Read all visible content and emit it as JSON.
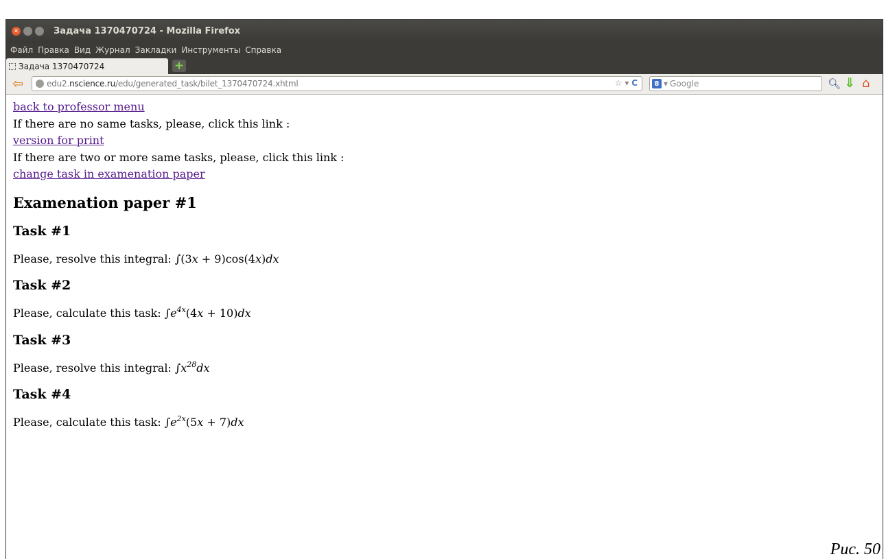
{
  "window": {
    "title": "Задача 1370470724 - Mozilla Firefox"
  },
  "menu": {
    "items": [
      {
        "label": "Файл"
      },
      {
        "label": "Правка"
      },
      {
        "label": "Вид"
      },
      {
        "label": "Журнал"
      },
      {
        "label": "Закладки"
      },
      {
        "label": "Инструменты"
      },
      {
        "label": "Справка"
      }
    ]
  },
  "tab": {
    "title": "Задача 1370470724",
    "new_tab_icon": "plus-icon"
  },
  "nav": {
    "url_host_prefix": "edu2.",
    "url_host_domain": "nscience.ru",
    "url_path": "/edu/generated_task/bilet_1370470724.xhtml",
    "search_placeholder": "Google",
    "search_engine_badge": "8"
  },
  "content": {
    "links": {
      "back": "back to professor menu",
      "print": "version for print",
      "change": "change task in examenation paper"
    },
    "hint_no_same": "If there are no same tasks, please, click this link :",
    "hint_two_or_more": "If there are two or more same tasks, please, click this link :",
    "paper_title": "Examenation paper #1",
    "tasks": [
      {
        "title": "Task #1",
        "prompt": "Please, resolve this integral:"
      },
      {
        "title": "Task #2",
        "prompt": "Please, calculate this task:"
      },
      {
        "title": "Task #3",
        "prompt": "Please, resolve this integral:"
      },
      {
        "title": "Task #4",
        "prompt": "Please, calculate this task:"
      }
    ]
  },
  "caption": "Рис. 50"
}
